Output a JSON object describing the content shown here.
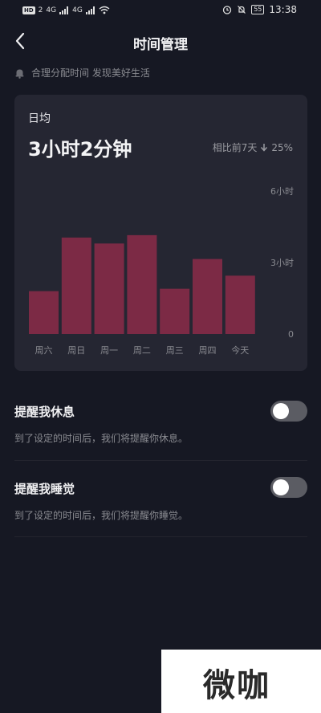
{
  "status_bar": {
    "hd_badge": "HD",
    "sim_indicator": "2",
    "network_1": "4G",
    "network_2": "4G",
    "battery": "55",
    "time": "13:38"
  },
  "header": {
    "title": "时间管理"
  },
  "tip": {
    "text": "合理分配时间 发现美好生活"
  },
  "summary": {
    "label": "日均",
    "value": "3小时2分钟",
    "compare_label": "相比前7天",
    "change": "25%",
    "change_direction": "down"
  },
  "chart_data": {
    "type": "bar",
    "categories": [
      "周六",
      "周日",
      "周一",
      "周二",
      "周三",
      "周四",
      "今天"
    ],
    "values": [
      1.8,
      4.05,
      3.8,
      4.15,
      1.9,
      3.15,
      2.45
    ],
    "y_tick_labels": [
      "6小时",
      "3小时",
      "0"
    ],
    "ylim": [
      0,
      6
    ],
    "bar_color": "#7c2a45",
    "grid": false
  },
  "settings": [
    {
      "title": "提醒我休息",
      "description": "到了设定的时间后，我们将提醒你休息。",
      "enabled": false
    },
    {
      "title": "提醒我睡觉",
      "description": "到了设定的时间后，我们将提醒你睡觉。",
      "enabled": false
    }
  ],
  "watermark": {
    "text": "微咖"
  },
  "colors": {
    "background": "#161823",
    "card": "#252632",
    "bar": "#7c2a45",
    "toggle_off": "#5b5c63"
  }
}
